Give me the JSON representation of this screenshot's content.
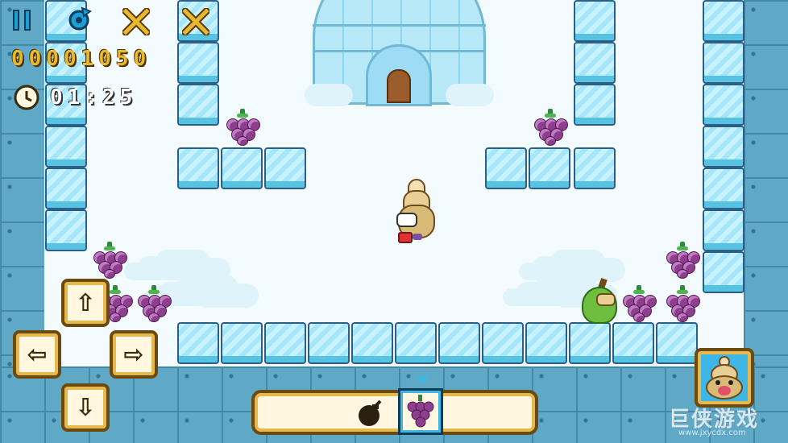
{
  "hud": {
    "score": "00001050",
    "timer": "01:25",
    "pause_icon": "pause-icon",
    "restart_icon": "restart-icon",
    "clock_icon": "clock-icon"
  },
  "colors": {
    "score_color": "#e8b830",
    "timer_color": "#ffffff",
    "ice_block": "#a6e6fb",
    "wall": "#5fa8c6",
    "grape": "#8d3f8e"
  },
  "controls": {
    "up": "⇧",
    "down": "⇩",
    "left": "⇦",
    "right": "⇨"
  },
  "inventory": {
    "items": [
      "bomb-icon",
      "grape-icon"
    ],
    "selected": "grape-icon"
  },
  "watermark": "巨侠游戏",
  "watermark_url": "www.jxycdx.com"
}
